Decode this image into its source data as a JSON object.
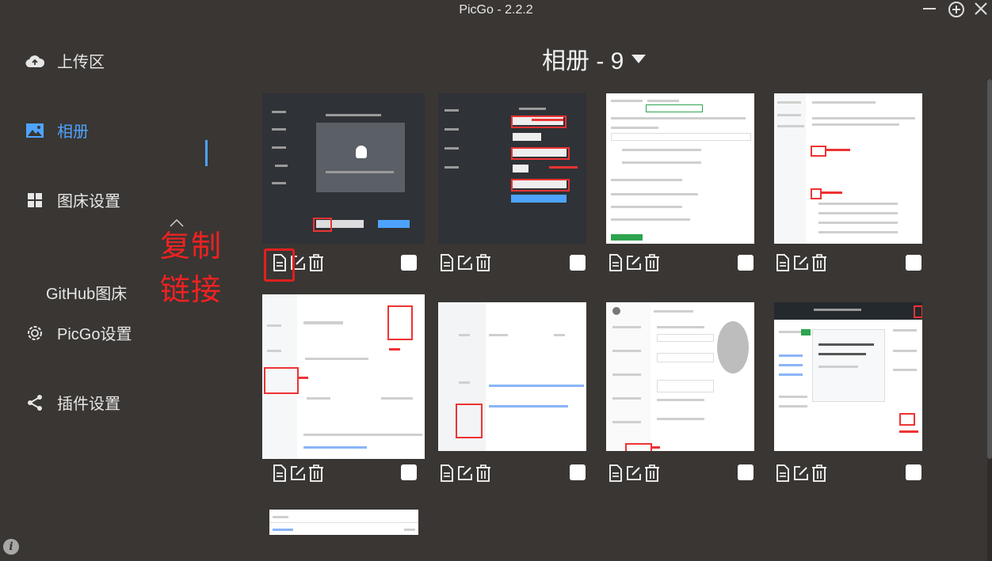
{
  "window": {
    "title": "PicGo - 2.2.2",
    "minimize_icon": "minus-icon",
    "maximize_icon": "plus-circle-icon",
    "close_icon": "close-icon"
  },
  "sidebar": {
    "items": [
      {
        "label": "上传区",
        "icon": "cloud-upload-icon"
      },
      {
        "label": "相册",
        "icon": "image-icon",
        "active": true
      },
      {
        "label": "图床设置",
        "icon": "grid-icon"
      },
      {
        "label": "PicGo设置",
        "icon": "gear-icon"
      },
      {
        "label": "插件设置",
        "icon": "share-icon"
      }
    ],
    "submenu_item": "GitHub图床",
    "annotation": "复制链接",
    "accent_color": "#4ea3ff"
  },
  "gallery": {
    "title": "相册 - 9",
    "count": 9,
    "action_icons": [
      "copy-link-icon",
      "edit-icon",
      "delete-icon"
    ]
  }
}
